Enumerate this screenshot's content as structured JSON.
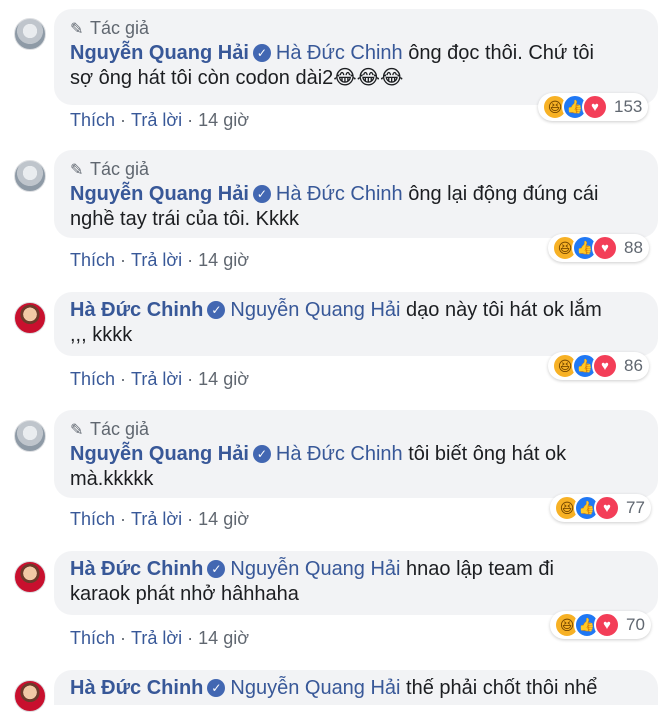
{
  "labels": {
    "author_tag": "Tác giả",
    "like": "Thích",
    "reply": "Trả lời",
    "separator": "·"
  },
  "comments": [
    {
      "author": "Nguyễn Quang Hải",
      "author_tag": true,
      "mention": "Hà Đức Chinh",
      "lines": [
        " ông đọc thôi. Chứ tôi",
        "sợ ông hát tôi còn codon dài2😂😂😂"
      ],
      "time": "14 giờ",
      "reaction_count": "153"
    },
    {
      "author": "Nguyễn Quang Hải",
      "author_tag": true,
      "mention": "Hà Đức Chinh",
      "lines": [
        " ông lại động đúng cái",
        "nghề tay trái của tôi. Kkkk"
      ],
      "time": "14 giờ",
      "reaction_count": "88"
    },
    {
      "author": "Hà Đức Chinh",
      "author_tag": false,
      "mention": "Nguyễn Quang Hải",
      "lines": [
        " dạo này tôi hát ok lắm",
        ",,, kkkk"
      ],
      "time": "14 giờ",
      "reaction_count": "86"
    },
    {
      "author": "Nguyễn Quang Hải",
      "author_tag": true,
      "mention": "Hà Đức Chinh",
      "lines": [
        " tôi biết ông hát ok",
        "mà.kkkkk"
      ],
      "time": "14 giờ",
      "reaction_count": "77"
    },
    {
      "author": "Hà Đức Chinh",
      "author_tag": false,
      "mention": "Nguyễn Quang Hải",
      "lines": [
        " hnao lập team đi",
        "karaok phát nhở hâhhaha"
      ],
      "time": "14 giờ",
      "reaction_count": "70"
    },
    {
      "author": "Hà Đức Chinh",
      "author_tag": false,
      "mention": "Nguyễn Quang Hải",
      "lines": [
        " thế phải chốt thôi nhể"
      ],
      "time": "",
      "reaction_count": ""
    }
  ],
  "icons": {
    "author_tag": "pencil-icon",
    "verified": "verified-badge-icon",
    "reactions": [
      "haha-reaction-icon",
      "like-reaction-icon",
      "love-reaction-icon"
    ]
  },
  "colors": {
    "link": "#385898",
    "bubble": "#f2f3f5",
    "meta": "#606770",
    "text": "#1c1e21"
  }
}
